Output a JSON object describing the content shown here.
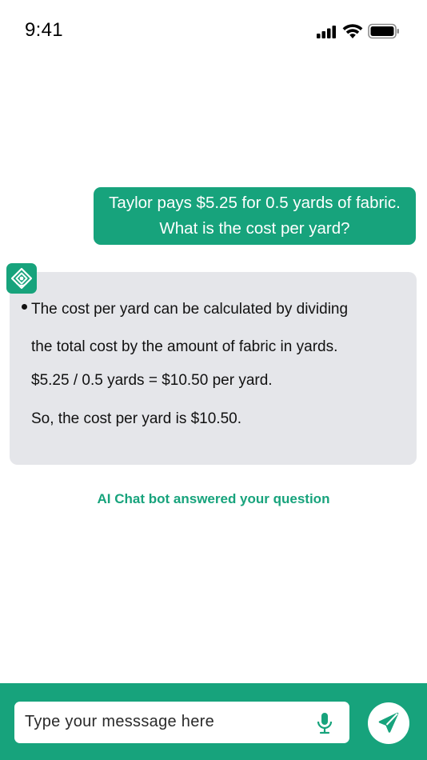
{
  "status_bar": {
    "time": "9:41",
    "icons": [
      "signal-icon",
      "wifi-icon",
      "battery-icon"
    ]
  },
  "chat": {
    "user_message": {
      "lines": [
        "Taylor pays $5.25 for 0.5 yards of fabric.",
        "What is the cost per yard?"
      ]
    },
    "bot_avatar_icon": "chatbot-logo-icon",
    "bot_message": {
      "lines": [
        "The cost per yard can be calculated by dividing",
        "the total cost by the amount of fabric in yards.",
        "$5.25 / 0.5 yards = $10.50 per yard.",
        "So, the cost per yard is $10.50."
      ]
    },
    "status_note": "AI Chat bot answered your question"
  },
  "composer": {
    "placeholder": "Type your messsage here",
    "mic_icon": "microphone-icon",
    "send_icon": "send-icon"
  },
  "colors": {
    "accent": "#17a37c",
    "bot_bubble": "#e5e6ea",
    "background": "#ffffff"
  }
}
